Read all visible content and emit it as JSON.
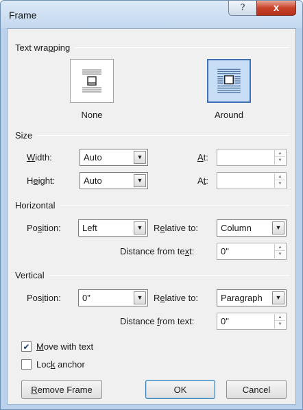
{
  "window": {
    "title": "Frame",
    "help_glyph": "?",
    "close_glyph": "x"
  },
  "text_wrapping": {
    "heading": "Text wrapping",
    "options": [
      {
        "label": "None",
        "selected": false
      },
      {
        "label": "Around",
        "selected": true
      }
    ]
  },
  "size": {
    "heading": "Size",
    "width": {
      "label": "Width:",
      "value": "Auto",
      "at_label": "At:",
      "at_value": ""
    },
    "height": {
      "label": "Height:",
      "value": "Auto",
      "at_label": "At:",
      "at_value": ""
    }
  },
  "horizontal": {
    "heading": "Horizontal",
    "position_label": "Position:",
    "position_value": "Left",
    "relative_label": "Relative to:",
    "relative_value": "Column",
    "distance_label": "Distance from text:",
    "distance_value": "0\""
  },
  "vertical": {
    "heading": "Vertical",
    "position_label": "Position:",
    "position_value": "0\"",
    "relative_label": "Relative to:",
    "relative_value": "Paragraph",
    "distance_label": "Distance from text:",
    "distance_value": "0\""
  },
  "options": {
    "move_with_text": {
      "label": "Move with text",
      "checked": true
    },
    "lock_anchor": {
      "label": "Lock anchor",
      "checked": false
    }
  },
  "buttons": {
    "remove_frame": "Remove Frame",
    "ok": "OK",
    "cancel": "Cancel"
  },
  "colors": {
    "accent": "#3f72b5",
    "selected_fill": "#c7def6",
    "close_red": "#c7432a"
  }
}
